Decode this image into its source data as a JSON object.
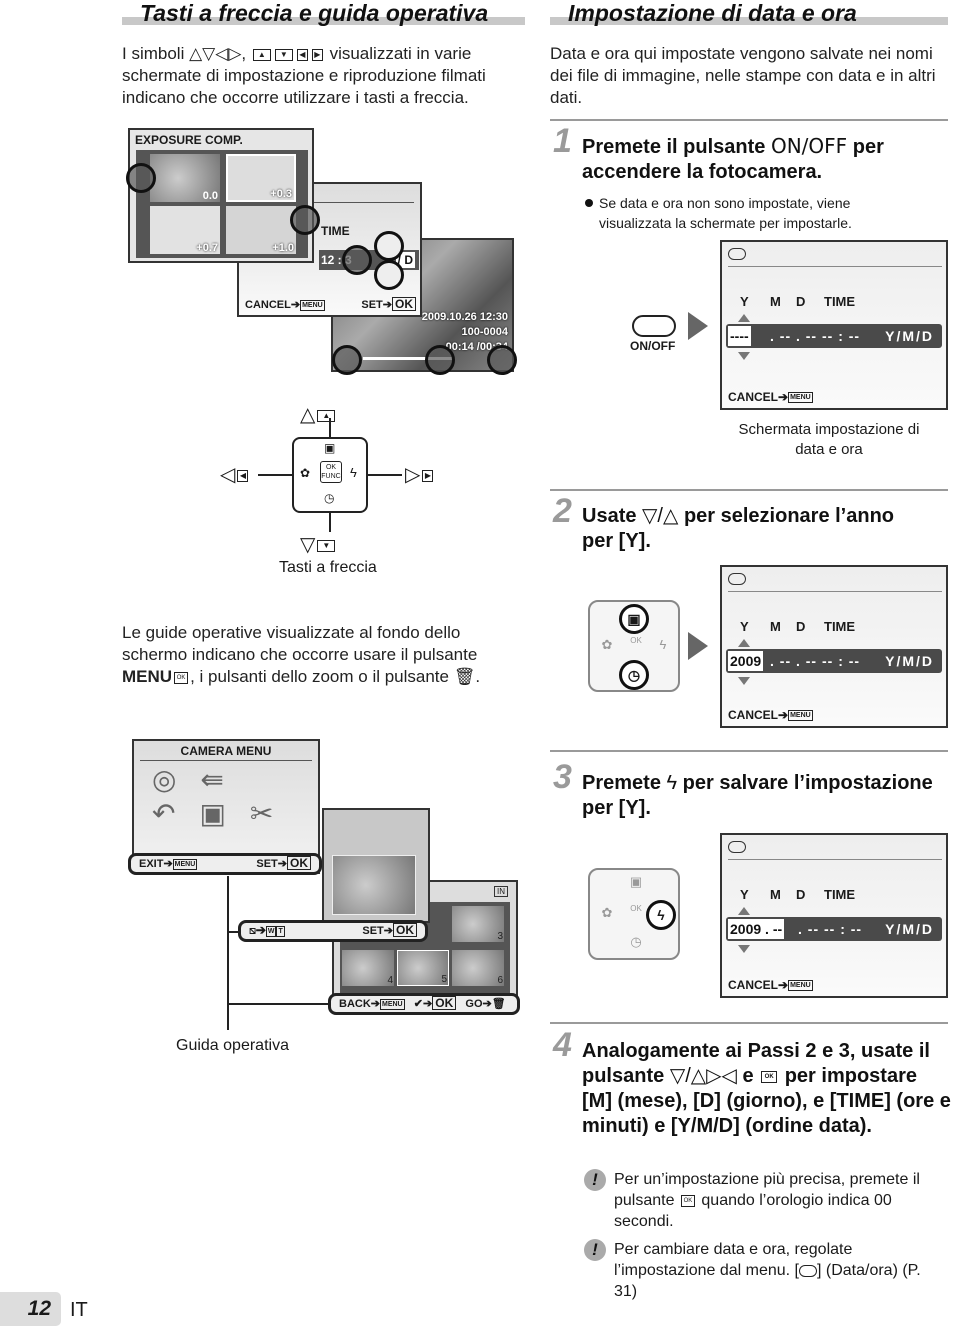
{
  "left_section": {
    "title": "Tasti a freccia e guida operativa",
    "intro_part1": "I simboli",
    "intro_symbols_a": "△▽◁▷",
    "intro_part2": "visualizzati in varie schermate di impostazione e riproduzione filmati indicano che occorre utilizzare i tasti a freccia.",
    "exposure_screen": {
      "title": "EXPOSURE COMP.",
      "values": [
        "0.0",
        "+0.3",
        "+0.7",
        "+1.0"
      ]
    },
    "time_screen": {
      "label": "TIME",
      "value": "12 : 3",
      "suffix": "/ D",
      "cancel": "CANCEL",
      "set": "SET",
      "ok": "OK",
      "menu": "MENU"
    },
    "movie_screen": {
      "date": "2009.10.26  12:30",
      "file": "100-0004",
      "time": "00:14  /00:34"
    },
    "arrow_keys_caption": "Tasti a freccia",
    "pad_labels": {
      "ok": "OK",
      "func": "FUNC"
    },
    "guide_text_1": "Le guide operative visualizzate al fondo dello schermo indicano che occorre usare il pulsante",
    "guide_text_menu": "MENU",
    "guide_text_2": ", i pulsanti dello zoom o il pulsante",
    "camera_menu": {
      "title": "CAMERA MENU",
      "exit": "EXIT",
      "set": "SET",
      "ok": "OK",
      "menu": "MENU"
    },
    "zoom_guide": {
      "w": "W",
      "t": "T",
      "set": "SET",
      "ok": "OK"
    },
    "erase_guide": {
      "back": "BACK",
      "menu": "MENU",
      "check": "✔",
      "ok": "OK",
      "go": "GO",
      "in": "IN",
      "thumb_numbers": [
        "2",
        "3",
        "4",
        "5",
        "6"
      ]
    },
    "guide_caption": "Guida operativa"
  },
  "right_section": {
    "title": "Impostazione di data e ora",
    "intro": "Data e ora qui impostate vengono salvate nei nomi dei file di immagine, nelle stampe con data e in altri dati.",
    "steps": [
      {
        "number": "1",
        "text_a": "Premete il pulsante",
        "text_key": "ON/OFF",
        "text_b": "per accendere la fotocamera.",
        "bullet": "Se data e ora non sono impostate, viene visualizzata la schermate per impostarle."
      },
      {
        "number": "2",
        "text_a": "Usate",
        "text_b": "per selezionare l’anno per [Y]."
      },
      {
        "number": "3",
        "text_a": "Premete",
        "text_b": "per salvare l’impostazione per [Y]."
      },
      {
        "number": "4",
        "text_a": "Analogamente ai Passi 2 e 3, usate il pulsante",
        "text_b": "e",
        "text_c": "per impostare [M] (mese), [D] (giorno), e [TIME] (ore e minuti) e [Y/M/D] (ordine data)."
      }
    ],
    "onoff_label": "ON/OFF",
    "screen_caption": "Schermata impostazione di data e ora",
    "date_screens": [
      {
        "labels": [
          "Y",
          "M",
          "D",
          "TIME"
        ],
        "selected": "----",
        "rest": ". -- . --   -- : --",
        "format": "Y/M/D",
        "cancel": "CANCEL",
        "menu": "MENU"
      },
      {
        "labels": [
          "Y",
          "M",
          "D",
          "TIME"
        ],
        "selected": "2009",
        "rest": ". -- . --   -- : --",
        "format": "Y/M/D",
        "cancel": "CANCEL",
        "menu": "MENU"
      },
      {
        "labels": [
          "Y",
          "M",
          "D",
          "TIME"
        ],
        "selected": "2009 . --",
        "rest": ". --   -- : --",
        "format": "Y/M/D",
        "cancel": "CANCEL",
        "menu": "MENU"
      }
    ],
    "notes": [
      {
        "a": "Per un’impostazione più precisa, premete il pulsante",
        "b": "quando l’orologio indica 00 secondi."
      },
      {
        "a": "Per cambiare data e ora, regolate l’impostazione dal menu. [",
        "b": "] (Data/ora) (P. 31)"
      }
    ]
  },
  "footer": {
    "page_number": "12",
    "language": "IT"
  }
}
